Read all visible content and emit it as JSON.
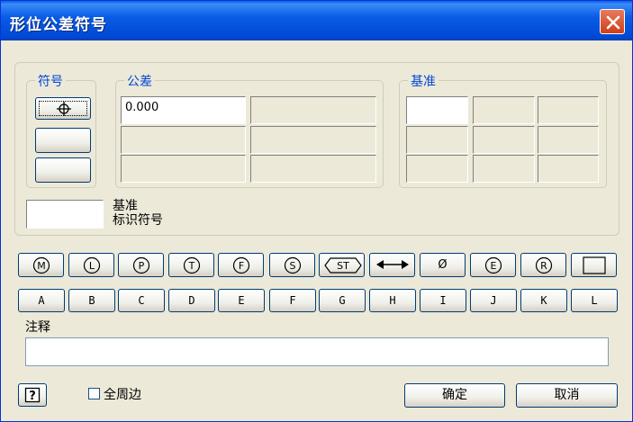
{
  "window": {
    "title": "形位公差符号"
  },
  "groups": {
    "symbol": "符号",
    "tolerance": "公差",
    "datum": "基准"
  },
  "tolerance": {
    "value1": "0.000"
  },
  "datum_identifier": {
    "line1": "基准",
    "line2": "标识符号"
  },
  "modifier_buttons": [
    {
      "name": "m-circle",
      "text": "M"
    },
    {
      "name": "l-circle",
      "text": "L"
    },
    {
      "name": "p-circle",
      "text": "P"
    },
    {
      "name": "t-circle",
      "text": "T"
    },
    {
      "name": "f-circle",
      "text": "F"
    },
    {
      "name": "s-circle",
      "text": "S"
    },
    {
      "name": "st-bracket",
      "text": "ST"
    },
    {
      "name": "double-arrow",
      "text": ""
    },
    {
      "name": "diameter",
      "text": "Ø"
    },
    {
      "name": "e-circle",
      "text": "E"
    },
    {
      "name": "r-circle",
      "text": "R"
    },
    {
      "name": "square",
      "text": ""
    }
  ],
  "letter_buttons": [
    "A",
    "B",
    "C",
    "D",
    "E",
    "F",
    "G",
    "H",
    "I",
    "J",
    "K",
    "L"
  ],
  "note": {
    "label": "注释",
    "value": ""
  },
  "all_around": {
    "label": "全周边",
    "checked": false
  },
  "buttons": {
    "ok": "确定",
    "cancel": "取消",
    "help": "?"
  }
}
